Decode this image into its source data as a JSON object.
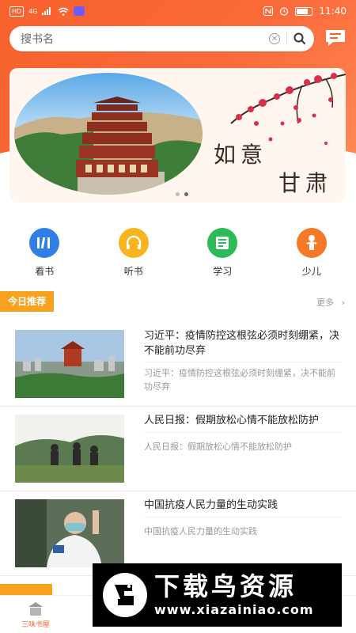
{
  "status_bar": {
    "left_chip": "HD",
    "net": "4G",
    "time": "11:40"
  },
  "search": {
    "placeholder": "搜书名",
    "clear_icon": "clear-icon",
    "search_icon": "search-icon"
  },
  "header": {
    "message_icon": "message-icon"
  },
  "banner": {
    "text_line1": "如意",
    "text_line2": "甘肃",
    "active_dot": 1,
    "dot_count": 2
  },
  "categories": [
    {
      "label": "看书",
      "icon": "book-icon",
      "color": "#2f7fe6"
    },
    {
      "label": "听书",
      "icon": "headphones-icon",
      "color": "#f6b51e"
    },
    {
      "label": "学习",
      "icon": "study-icon",
      "color": "#2dbb5a"
    },
    {
      "label": "少儿",
      "icon": "child-icon",
      "color": "#f47a28"
    }
  ],
  "section": {
    "title": "今日推荐",
    "more": "更多"
  },
  "news": [
    {
      "title": "习近平：疫情防控这根弦必须时刻绷紧，决不能前功尽弃",
      "desc": "习近平：疫情防控这根弦必须时刻绷紧，决不能前功尽弃"
    },
    {
      "title": "人民日报：假期放松心情不能放松防护",
      "desc": "人民日报：假期放松心情不能放松防护"
    },
    {
      "title": "中国抗疫人民力量的生动实践",
      "desc": "中国抗疫人民力量的生动实践"
    }
  ],
  "tabbar": [
    {
      "label": "三味书屋",
      "active": true
    },
    {
      "label": "",
      "active": false
    },
    {
      "label": "",
      "active": false
    },
    {
      "label": "",
      "active": false
    },
    {
      "label": "",
      "active": false
    }
  ],
  "watermark": {
    "title": "下载鸟资源",
    "url": "www.xiazainiao.com"
  },
  "colors": {
    "accent": "#f7612d",
    "tag": "#f7a21e"
  }
}
